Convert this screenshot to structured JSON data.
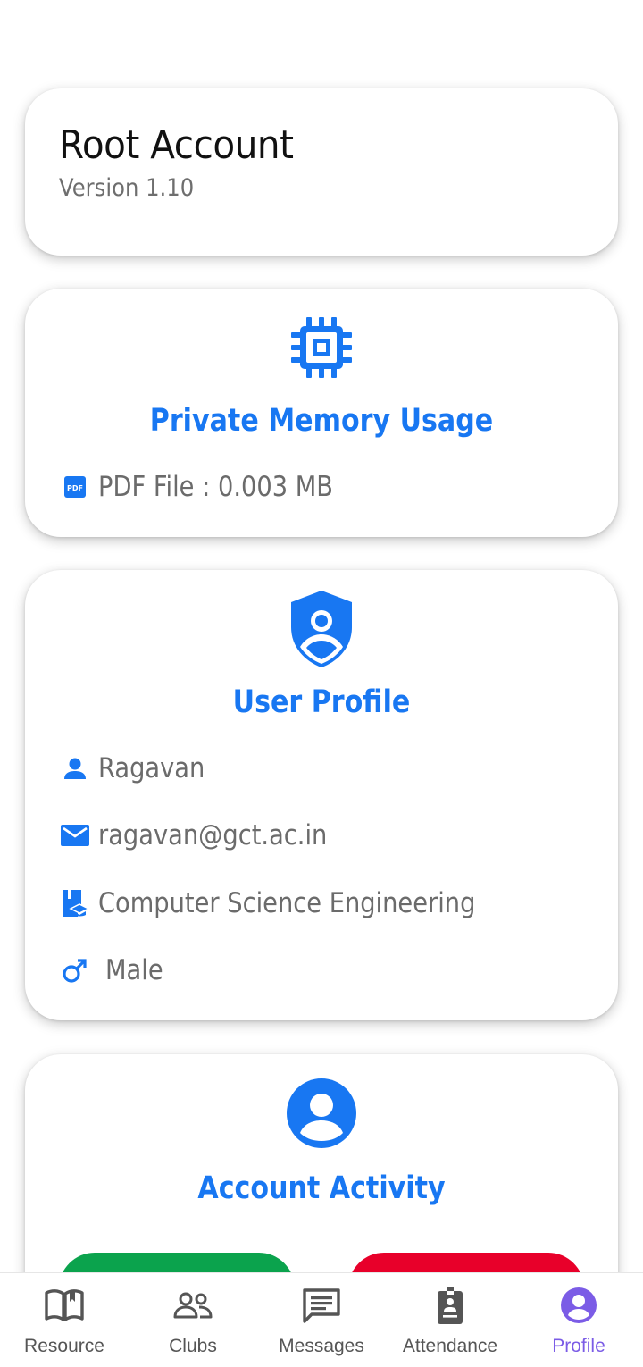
{
  "root_card": {
    "title": "Root Account",
    "version": "Version 1.10"
  },
  "memory_card": {
    "icon": "memory-chip-icon",
    "heading": "Private Memory Usage",
    "pdf_text": "PDF File : 0.003 MB"
  },
  "profile_card": {
    "icon": "shield-user-icon",
    "heading": "User Profile",
    "name": "Ragavan",
    "email": "ragavan@gct.ac.in",
    "department": "Computer Science Engineering",
    "gender": "Male"
  },
  "activity_card": {
    "icon": "account-circle-icon",
    "heading": "Account Activity"
  },
  "nav": {
    "items": [
      {
        "label": "Resource",
        "icon": "book-icon"
      },
      {
        "label": "Clubs",
        "icon": "people-icon"
      },
      {
        "label": "Messages",
        "icon": "message-icon"
      },
      {
        "label": "Attendance",
        "icon": "badge-icon"
      },
      {
        "label": "Profile",
        "icon": "profile-icon"
      }
    ],
    "active": "Profile"
  },
  "colors": {
    "accent": "#1877f2",
    "nav_active": "#7b5ce6",
    "green": "#0ba34d",
    "red": "#e8002a"
  }
}
